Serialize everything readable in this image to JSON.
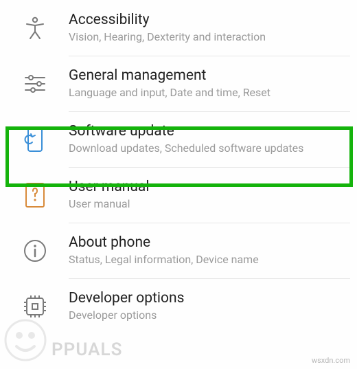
{
  "settings": [
    {
      "id": "accessibility",
      "title": "Accessibility",
      "subtitle": "Vision, Hearing, Dexterity and interaction",
      "icon": "accessibility-icon",
      "color": "#7a7a7a"
    },
    {
      "id": "general-management",
      "title": "General management",
      "subtitle": "Language and input, Date and time, Reset",
      "icon": "sliders-icon",
      "color": "#7a7a7a"
    },
    {
      "id": "software-update",
      "title": "Software update",
      "subtitle": "Download updates, Scheduled software updates",
      "icon": "refresh-device-icon",
      "color": "#3a8fd8"
    },
    {
      "id": "user-manual",
      "title": "User manual",
      "subtitle": "User manual",
      "icon": "manual-icon",
      "color": "#d88a3a"
    },
    {
      "id": "about-phone",
      "title": "About phone",
      "subtitle": "Status, Legal information, Device name",
      "icon": "info-icon",
      "color": "#7a7a7a"
    },
    {
      "id": "developer-options",
      "title": "Developer options",
      "subtitle": "Developer options",
      "icon": "developer-icon",
      "color": "#7a7a7a"
    }
  ],
  "highlighted_index": 2,
  "watermark": {
    "text": "PPUALS",
    "site": "wsxdn.com"
  }
}
